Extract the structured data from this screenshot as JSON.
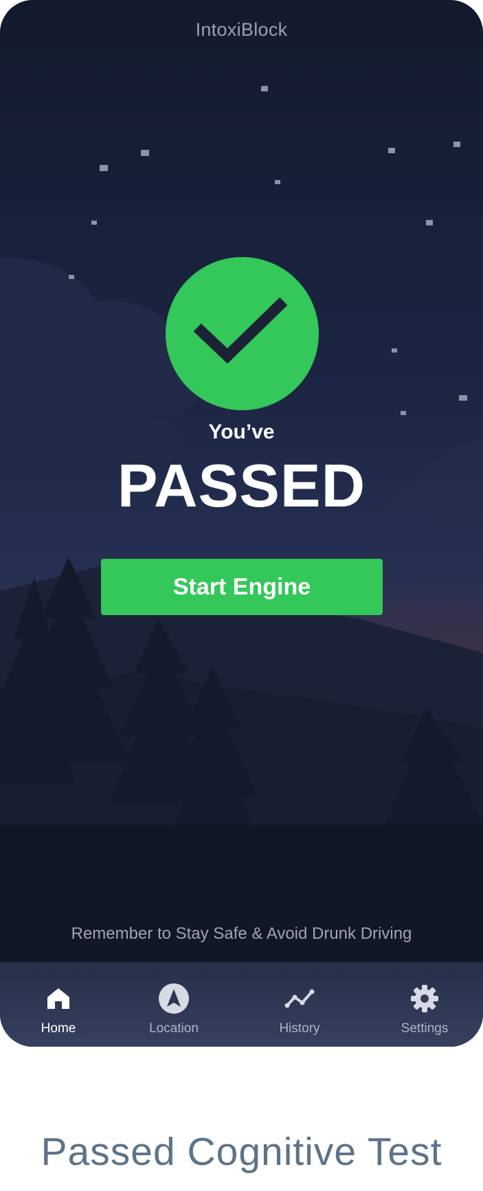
{
  "app": {
    "title": "IntoxiBlock"
  },
  "result": {
    "prefix": "You’ve",
    "status": "PASSED"
  },
  "actions": {
    "start_engine_label": "Start Engine"
  },
  "footer": {
    "reminder": "Remember to Stay Safe & Avoid Drunk Driving"
  },
  "nav": {
    "items": [
      {
        "label": "Home",
        "icon": "home-icon",
        "active": true
      },
      {
        "label": "Location",
        "icon": "navigation-arrow-icon",
        "active": false
      },
      {
        "label": "History",
        "icon": "trend-line-icon",
        "active": false
      },
      {
        "label": "Settings",
        "icon": "gear-icon",
        "active": false
      }
    ]
  },
  "caption": "Passed Cognitive Test",
  "colors": {
    "accent": "#34c759",
    "background": "#151b2d",
    "nav_bg": "#2f3954",
    "caption": "#5d7388"
  }
}
